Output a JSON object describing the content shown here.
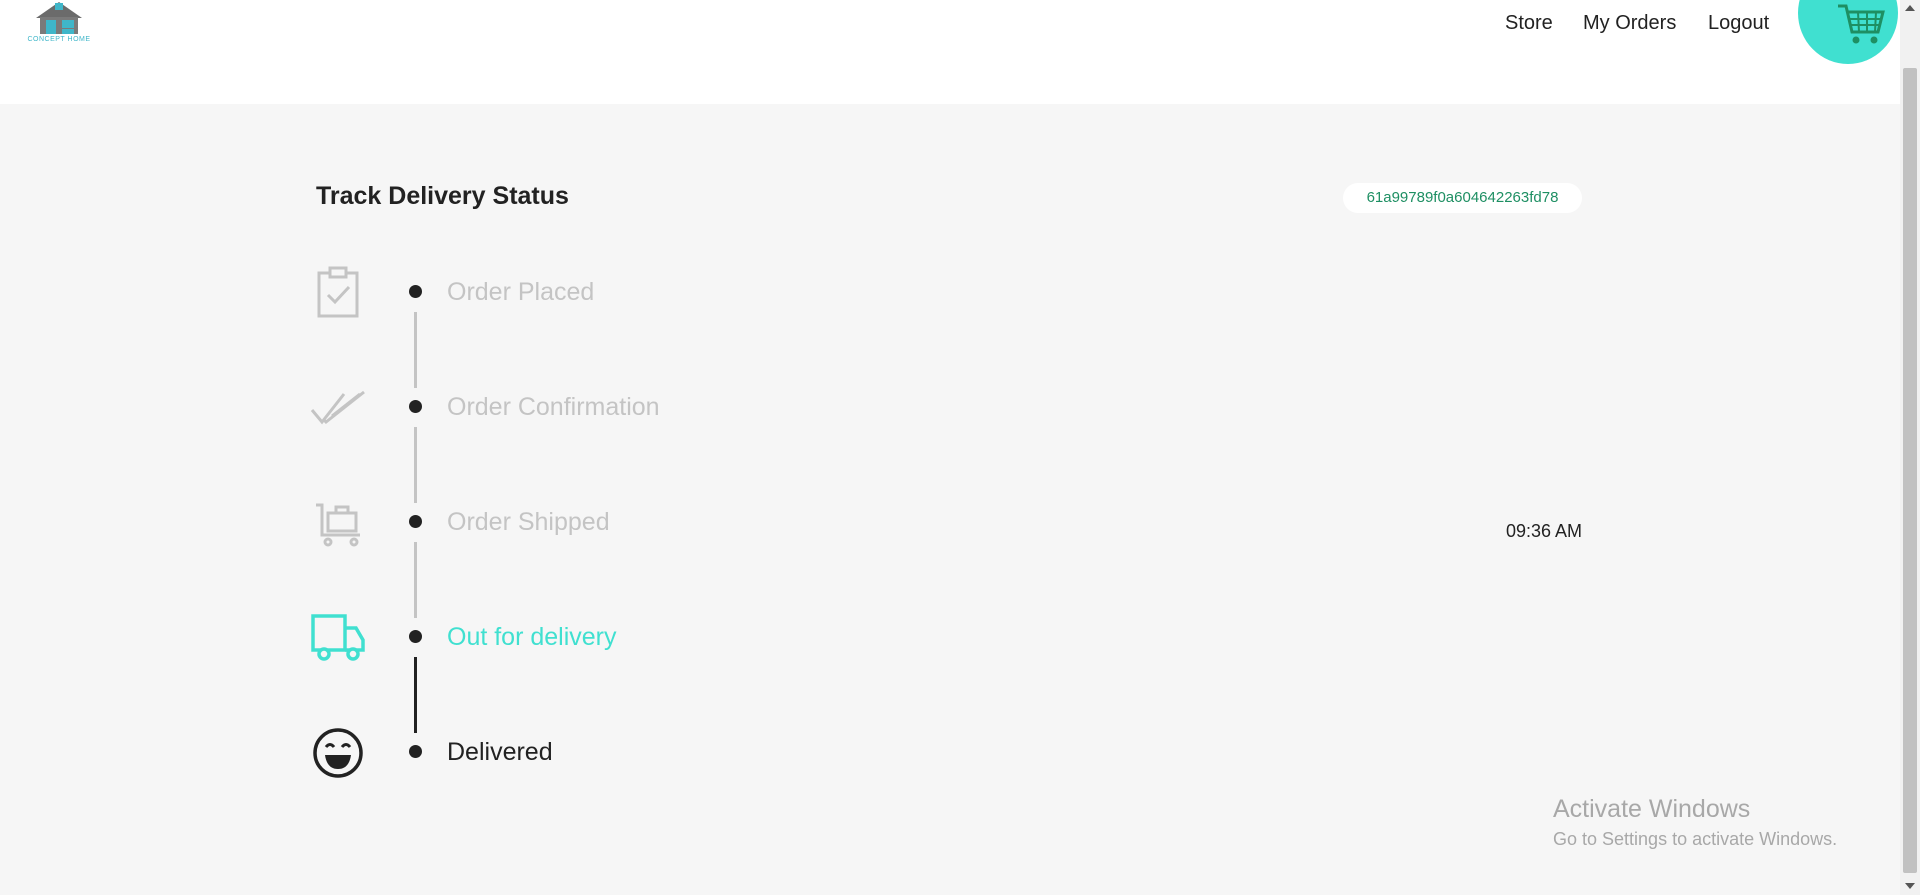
{
  "header": {
    "logo_text": "CONCEPT HOME",
    "nav": {
      "store": "Store",
      "my_orders": "My Orders",
      "logout": "Logout"
    },
    "cart_icon": "shopping-cart-icon"
  },
  "main": {
    "title": "Track Delivery Status",
    "order_id": "61a99789f0a604642263fd78",
    "steps": [
      {
        "label": "Order Placed",
        "icon": "clipboard-check-icon",
        "state": "done"
      },
      {
        "label": "Order Confirmation",
        "icon": "double-check-icon",
        "state": "done"
      },
      {
        "label": "Order Shipped",
        "icon": "luggage-cart-icon",
        "state": "done"
      },
      {
        "label": "Out for delivery",
        "icon": "truck-icon",
        "state": "active"
      },
      {
        "label": "Delivered",
        "icon": "smile-icon",
        "state": "current"
      }
    ],
    "time": "09:36 AM"
  },
  "watermark": {
    "title": "Activate Windows",
    "subtitle": "Go to Settings to activate Windows."
  },
  "colors": {
    "accent": "#40e0d0",
    "order_id_text": "#1e8f63",
    "inactive_label": "#c4c4c4"
  }
}
